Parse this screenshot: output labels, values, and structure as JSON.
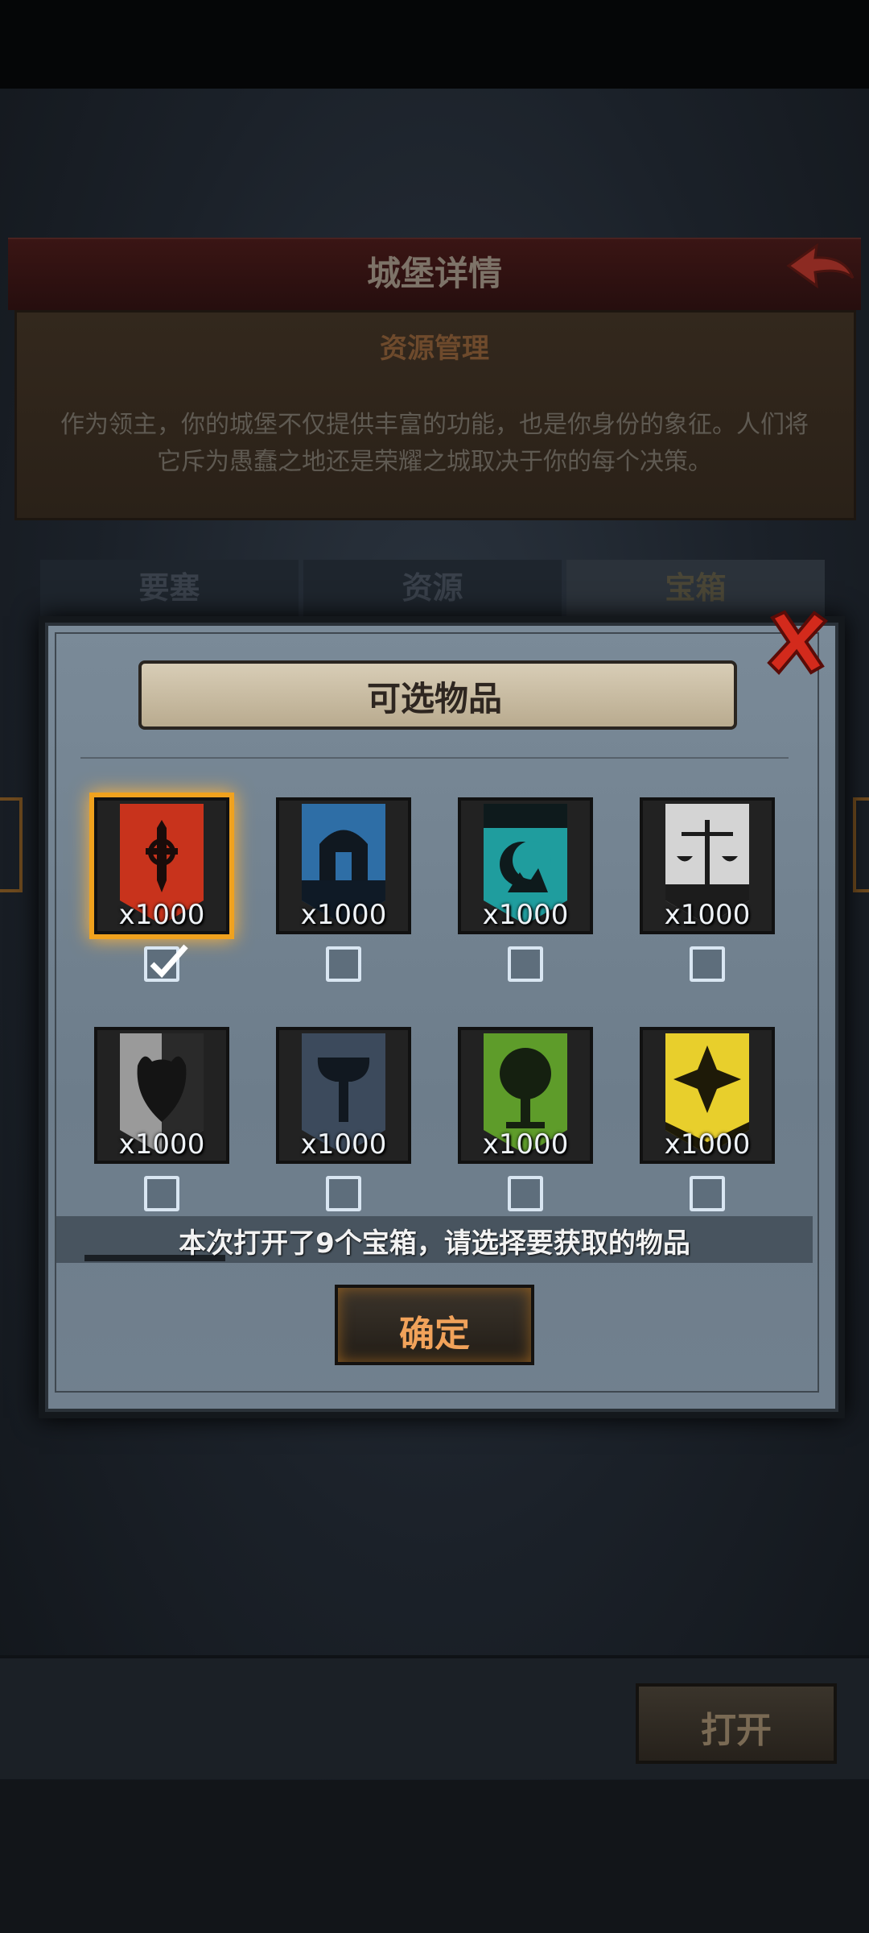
{
  "header": {
    "title": "城堡详情"
  },
  "info": {
    "subtitle": "资源管理",
    "description": "作为领主，你的城堡不仅提供丰富的功能，也是你身份的象征。人们将它斥为愚蠢之地还是荣耀之城取决于你的每个决策。"
  },
  "tabs": [
    {
      "label": "要塞"
    },
    {
      "label": "资源"
    },
    {
      "label": "宝箱"
    }
  ],
  "modal": {
    "title": "可选物品",
    "items": [
      {
        "icon": "sword-banner-icon",
        "qty": "x1000",
        "checked": true,
        "color": "#c8331c"
      },
      {
        "icon": "castle-banner-icon",
        "qty": "x1000",
        "checked": false,
        "color": "#2e6ea6"
      },
      {
        "icon": "moon-banner-icon",
        "qty": "x1000",
        "checked": false,
        "color": "#1f9d9e"
      },
      {
        "icon": "scales-banner-icon",
        "qty": "x1000",
        "checked": false,
        "color": "#cfcfcf"
      },
      {
        "icon": "demon-banner-icon",
        "qty": "x1000",
        "checked": false,
        "color": "#8f8f8f"
      },
      {
        "icon": "axe-banner-icon",
        "qty": "x1000",
        "checked": false,
        "color": "#3c4a5c"
      },
      {
        "icon": "tree-banner-icon",
        "qty": "x1000",
        "checked": false,
        "color": "#5e9c2a"
      },
      {
        "icon": "cross-banner-icon",
        "qty": "x1000",
        "checked": false,
        "color": "#e8cf2c"
      }
    ],
    "message": "本次打开了9个宝箱，请选择要获取的物品",
    "confirm_label": "确定"
  },
  "footer": {
    "open_label": "打开"
  }
}
